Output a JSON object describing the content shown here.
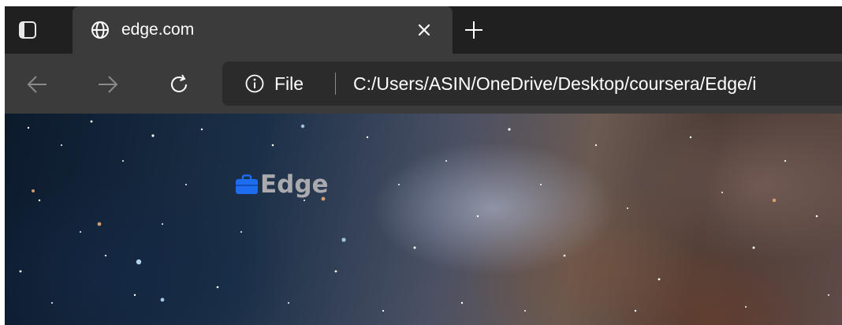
{
  "tabs": [
    {
      "title": "edge.com",
      "favicon": "globe-icon",
      "active": true
    }
  ],
  "tabstrip": {
    "tab_actions_icon": "tab-actions-icon",
    "close_icon": "close-icon",
    "new_tab_icon": "plus-icon"
  },
  "toolbar": {
    "back_icon": "arrow-left-icon",
    "forward_icon": "arrow-right-icon",
    "refresh_icon": "refresh-icon"
  },
  "address_bar": {
    "info_icon": "info-icon",
    "site_label": "File",
    "url": "C:/Users/ASIN/OneDrive/Desktop/coursera/Edge/i"
  },
  "page": {
    "logo_icon": "briefcase-icon",
    "logo_text": "Edge"
  },
  "colors": {
    "tabstrip_bg": "#202020",
    "toolbar_bg": "#3b3b3b",
    "address_bg": "#2b2b2b",
    "logo_icon": "#1e6cf0",
    "logo_text": "#a9a9ae"
  }
}
